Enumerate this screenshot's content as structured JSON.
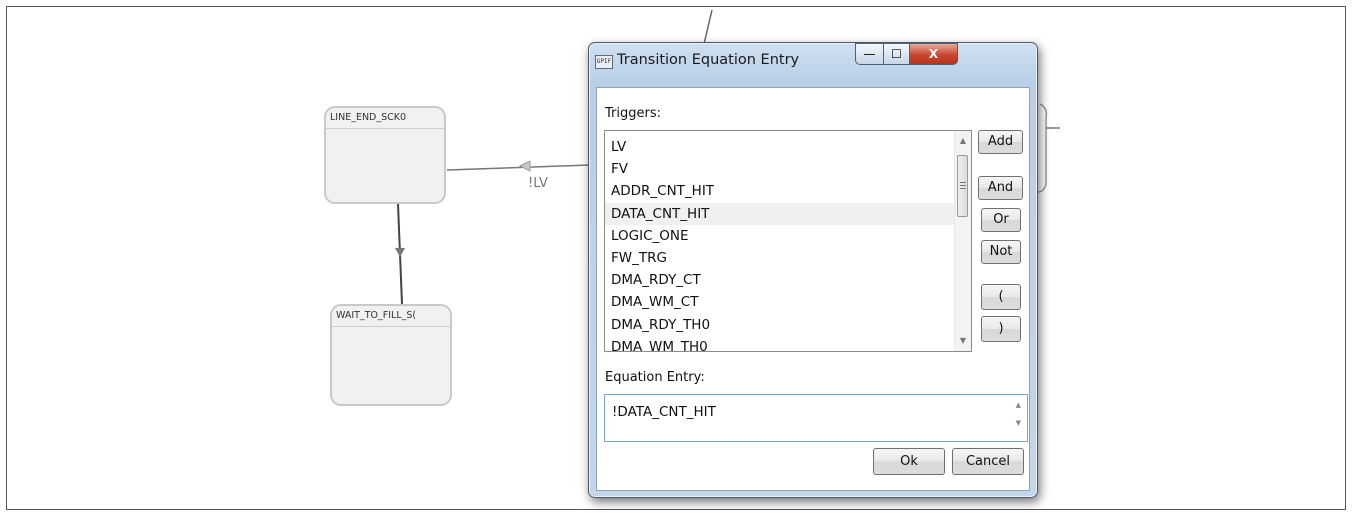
{
  "canvas": {
    "states": [
      {
        "title": "LINE_END_SCK0"
      },
      {
        "title": "WAIT_TO_FILL_S("
      }
    ],
    "edge_label": "!LV"
  },
  "dialog": {
    "icon_text": "GPIF",
    "title": "Transition Equation Entry",
    "controls": {
      "minimize": "—",
      "maximize": "☐",
      "close": "X"
    },
    "triggers_label": "Triggers:",
    "triggers": [
      "LV",
      "FV",
      "ADDR_CNT_HIT",
      "DATA_CNT_HIT",
      "LOGIC_ONE",
      "FW_TRG",
      "DMA_RDY_CT",
      "DMA_WM_CT",
      "DMA_RDY_TH0",
      "DMA_WM_TH0"
    ],
    "selected_trigger": "DATA_CNT_HIT",
    "buttons": {
      "add": "Add",
      "and": "And",
      "or": "Or",
      "not": "Not",
      "open_paren": "(",
      "close_paren": ")"
    },
    "equation_label": "Equation Entry:",
    "equation_value": "!DATA_CNT_HIT",
    "ok": "Ok",
    "cancel": "Cancel"
  }
}
